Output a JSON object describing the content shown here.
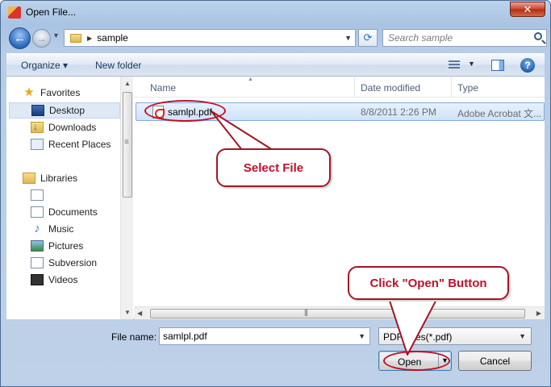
{
  "window": {
    "title": "Open File..."
  },
  "nav": {
    "breadcrumb": "sample",
    "search_placeholder": "Search sample"
  },
  "toolbar": {
    "organize_label": "Organize ▾",
    "new_folder_label": "New folder"
  },
  "sidebar": {
    "items": [
      {
        "label": "Favorites",
        "icon": "star-icon"
      },
      {
        "label": "Desktop",
        "icon": "desktop-icon"
      },
      {
        "label": "Downloads",
        "icon": "downloads-folder-icon"
      },
      {
        "label": "Recent Places",
        "icon": "recent-places-icon"
      },
      {
        "label": "Libraries",
        "icon": "libraries-icon"
      },
      {
        "label": "",
        "icon": "library-item-icon"
      },
      {
        "label": "Documents",
        "icon": "documents-icon"
      },
      {
        "label": "Music",
        "icon": "music-icon"
      },
      {
        "label": "Pictures",
        "icon": "pictures-icon"
      },
      {
        "label": "Subversion",
        "icon": "subversion-icon"
      },
      {
        "label": "Videos",
        "icon": "videos-icon"
      }
    ]
  },
  "file_list": {
    "columns": [
      "Name",
      "Date modified",
      "Type"
    ],
    "rows": [
      {
        "name": "samlpl.pdf",
        "date": "8/8/2011 2:26 PM",
        "type": "Adobe Acrobat 文..."
      }
    ]
  },
  "footer": {
    "filename_label": "File name:",
    "filename_value": "samlpl.pdf",
    "filter_value": "PDF Files(*.pdf)",
    "open_label": "Open",
    "cancel_label": "Cancel"
  },
  "annotations": {
    "select_file": "Select File",
    "click_open": "Click \"Open\" Button",
    "color": "#c0102a"
  }
}
